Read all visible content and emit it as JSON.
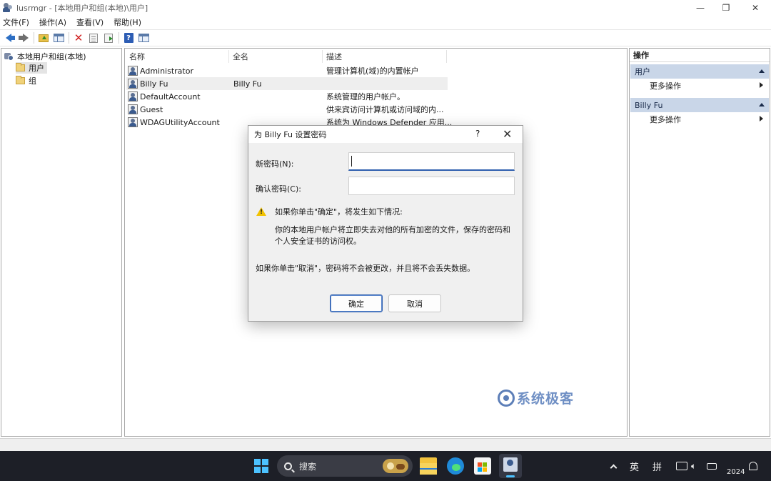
{
  "window": {
    "title": "lusrmgr - [本地用户和组(本地)\\用户]",
    "controls": {
      "minimize": "—",
      "restore": "❐",
      "close": "✕"
    }
  },
  "menu": [
    "文件(F)",
    "操作(A)",
    "查看(V)",
    "帮助(H)"
  ],
  "toolbar": {
    "icons": [
      "back-icon",
      "forward-icon",
      "up-folder-icon",
      "show-hide-tree-icon",
      "delete-icon",
      "properties-icon",
      "export-list-icon",
      "help-icon",
      "action-pane-icon"
    ]
  },
  "tree": {
    "root": "本地用户和组(本地)",
    "items": [
      {
        "label": "用户",
        "selected": true
      },
      {
        "label": "组",
        "selected": false
      }
    ]
  },
  "list": {
    "columns": [
      "名称",
      "全名",
      "描述"
    ],
    "rows": [
      {
        "name": "Administrator",
        "fullname": "",
        "description": "管理计算机(域)的内置帐户"
      },
      {
        "name": "Billy Fu",
        "fullname": "Billy Fu",
        "description": ""
      },
      {
        "name": "DefaultAccount",
        "fullname": "",
        "description": "系统管理的用户帐户。"
      },
      {
        "name": "Guest",
        "fullname": "",
        "description": "供来宾访问计算机或访问域的内..."
      },
      {
        "name": "WDAGUtilityAccount",
        "fullname": "",
        "description": "系统为 Windows Defender 应用..."
      }
    ]
  },
  "actions": {
    "title": "操作",
    "sections": [
      {
        "heading": "用户",
        "items": [
          "更多操作"
        ]
      },
      {
        "heading": "Billy Fu",
        "items": [
          "更多操作"
        ]
      }
    ]
  },
  "dialog": {
    "title": "为 Billy Fu 设置密码",
    "help": "?",
    "close": "✕",
    "new_password_label": "新密码(N):",
    "new_password_value": "",
    "confirm_password_label": "确认密码(C):",
    "confirm_password_value": "",
    "warning_heading": "如果你单击\"确定\"，将发生如下情况:",
    "warning_body": "你的本地用户帐户将立即失去对他的所有加密的文件，保存的密码和个人安全证书的访问权。",
    "cancel_note": "如果你单击\"取消\"，密码将不会被更改，并且将不会丢失数据。",
    "ok_label": "确定",
    "cancel_label": "取消"
  },
  "watermark": "系统极客",
  "taskbar": {
    "search_label": "搜索",
    "apps": [
      "file-explorer-icon",
      "edge-icon",
      "store-icon",
      "lusrmgr-icon"
    ],
    "tray": {
      "ime_mode": "英",
      "ime_name": "拼",
      "clock": "2024"
    }
  },
  "colors": {
    "accent": "#2f5fae",
    "section_header": "#c9d6e8",
    "taskbar": "#1d1f27",
    "warning": "#f2c200"
  }
}
